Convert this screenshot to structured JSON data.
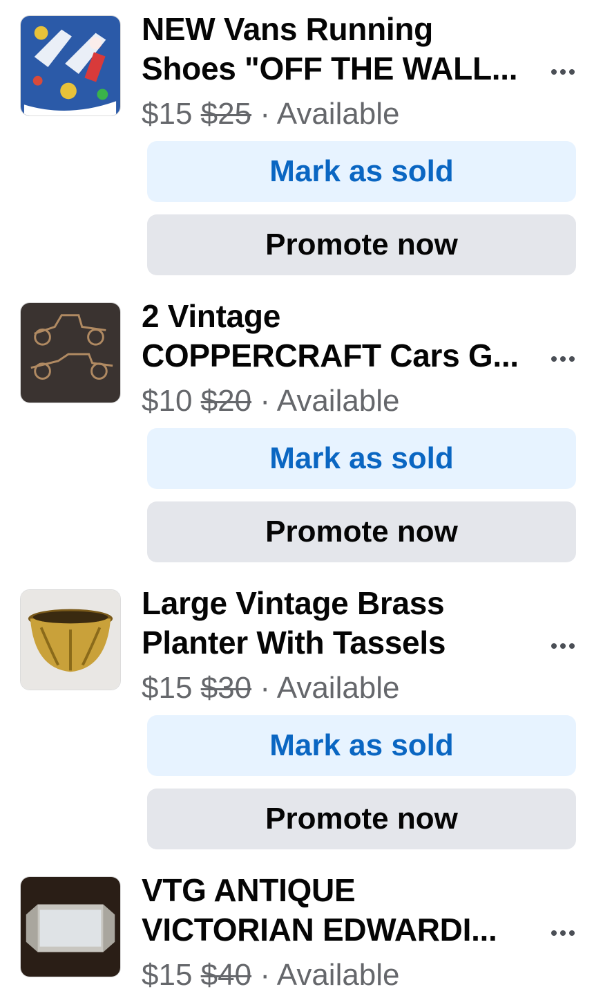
{
  "listings": [
    {
      "title_line1": "NEW Vans Running",
      "title_line2": "Shoes \"OFF THE WALL...",
      "price": "$15",
      "original_price": "$25",
      "separator": "·",
      "status": "Available",
      "thumbnail": "sneakers-photo",
      "mark_sold_label": "Mark as sold",
      "promote_label": "Promote now"
    },
    {
      "title_line1": "2 Vintage",
      "title_line2": "COPPERCRAFT Cars G...",
      "price": "$10",
      "original_price": "$20",
      "separator": "·",
      "status": "Available",
      "thumbnail": "copper-cars-photo",
      "mark_sold_label": "Mark as sold",
      "promote_label": "Promote now"
    },
    {
      "title_line1": "Large Vintage Brass",
      "title_line2": "Planter With Tassels",
      "price": "$15",
      "original_price": "$30",
      "separator": "·",
      "status": "Available",
      "thumbnail": "brass-planter-photo",
      "mark_sold_label": "Mark as sold",
      "promote_label": "Promote now"
    },
    {
      "title_line1": "VTG ANTIQUE",
      "title_line2": "VICTORIAN EDWARDI...",
      "price": "$15",
      "original_price": "$40",
      "separator": "·",
      "status": "Available",
      "thumbnail": "mirror-tray-photo"
    }
  ],
  "more_icon": "more-options-icon",
  "colors": {
    "sold_button_bg": "#e7f3ff",
    "sold_button_text": "#0a66c2",
    "promote_button_bg": "#e4e6eb",
    "price_text": "#65676b"
  }
}
